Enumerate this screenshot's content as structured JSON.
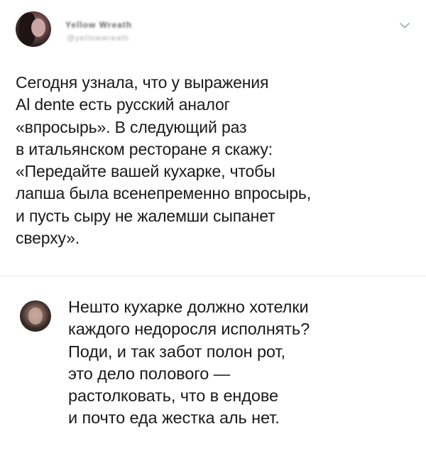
{
  "tweet": {
    "author_name": "Yellow Wreath",
    "author_handle": "@yellowwreath",
    "text_lines": [
      "Сегодня узнала, что у выражения",
      "Al dente есть русский аналог",
      "«впросырь». В следующий раз",
      "в итальянском ресторане я скажу:",
      "«Передайте вашей кухарке, чтобы",
      "лапша была всенепременно впросырь,",
      "и пусть сыру не жалемши сыпанет",
      "сверху»."
    ]
  },
  "reply": {
    "text_lines": [
      "Нешто кухарке должно хотелки",
      "каждого недоросля исполнять?",
      "Поди, и так забот полон рот,",
      "это дело полового —",
      "растолковать, что в ендове",
      "и почто еда жестка аль нет."
    ]
  },
  "icons": {
    "menu": "chevron-down-icon"
  },
  "colors": {
    "text": "#1a1a1a",
    "divider": "#e6ecf0",
    "chevron": "#8899a6"
  }
}
